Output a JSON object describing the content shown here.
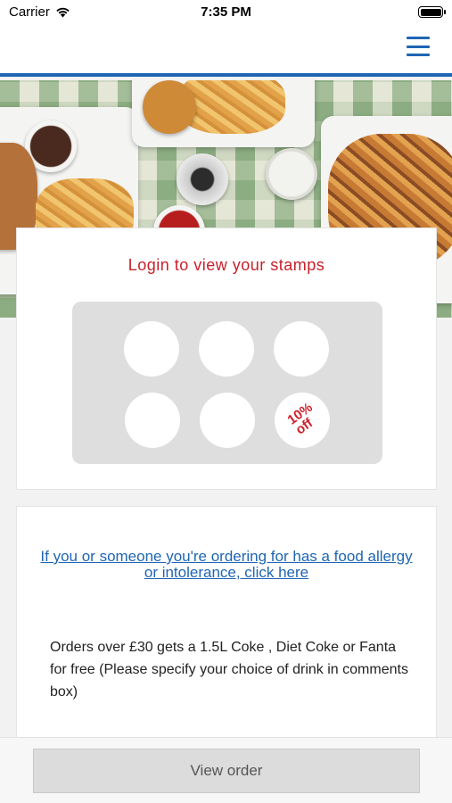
{
  "status_bar": {
    "carrier": "Carrier",
    "time": "7:35 PM",
    "wifi_icon": "wifi-icon",
    "battery_icon": "battery-icon"
  },
  "navbar": {
    "menu_icon": "hamburger-menu-icon",
    "accent_color": "#1f65b3"
  },
  "hero": {
    "image": "fish-and-chips-table-photo"
  },
  "stamp_card": {
    "title": "Login to view your stamps",
    "title_color": "#c8202a",
    "stamps": [
      {
        "filled": false
      },
      {
        "filled": false
      },
      {
        "filled": false
      },
      {
        "filled": false
      },
      {
        "filled": false
      },
      {
        "filled": false,
        "reward": "10% off"
      }
    ],
    "reward_text_line1": "10%",
    "reward_text_line2": "off"
  },
  "info_card": {
    "allergy_link": "If you or someone you're ordering for has a food allergy or intolerance, click here",
    "offer_text": "Orders over £30 gets a 1.5L Coke , Diet Coke or Fanta for free (Please specify your choice of drink in comments box)"
  },
  "footer": {
    "view_order_label": "View order"
  }
}
